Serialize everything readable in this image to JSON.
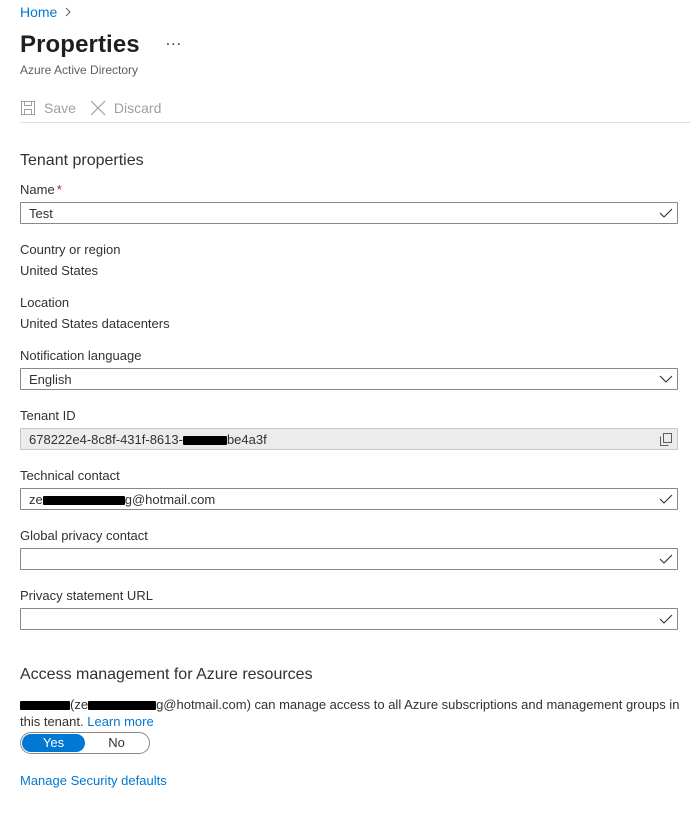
{
  "breadcrumb": {
    "home": "Home"
  },
  "header": {
    "title": "Properties",
    "more": "...",
    "subtitle": "Azure Active Directory"
  },
  "toolbar": {
    "save_label": "Save",
    "discard_label": "Discard"
  },
  "tenant": {
    "section_title": "Tenant properties",
    "name_label": "Name",
    "name_required": "*",
    "name_value": "Test",
    "country_label": "Country or region",
    "country_value": "United States",
    "location_label": "Location",
    "location_value": "United States datacenters",
    "notification_label": "Notification language",
    "notification_value": "English",
    "tenant_id_label": "Tenant ID",
    "tenant_id_prefix": "678222e4-8c8f-431f-8613-",
    "tenant_id_suffix": "be4a3f",
    "tech_contact_label": "Technical contact",
    "tech_contact_prefix": "ze",
    "tech_contact_suffix": "g@hotmail.com",
    "privacy_contact_label": "Global privacy contact",
    "privacy_contact_value": "",
    "privacy_url_label": "Privacy statement URL",
    "privacy_url_value": ""
  },
  "access": {
    "section_title": "Access management for Azure resources",
    "text_open": "(ze",
    "text_mid": "g@hotmail.com) can manage access to all Azure subscriptions and management groups in this tenant.",
    "learn_more": "Learn more",
    "yes": "Yes",
    "no": "No",
    "selected": "Yes"
  },
  "footer": {
    "security_defaults_link": "Manage Security defaults"
  },
  "colors": {
    "accent": "#0078d4",
    "required": "#a4262c",
    "disabled_bg": "#ececec"
  },
  "icons": [
    "chevron-right-icon",
    "save-icon",
    "close-icon",
    "checkmark-icon",
    "chevron-down-icon",
    "copy-icon"
  ]
}
